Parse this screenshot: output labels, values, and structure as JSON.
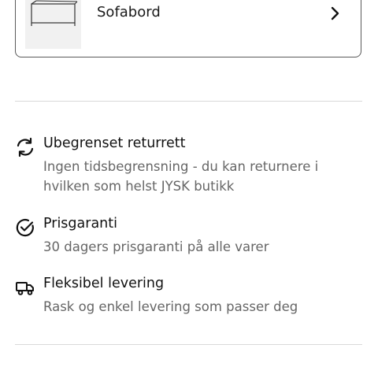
{
  "product_card": {
    "title": "Sofabord",
    "thumbnail_icon": "coffee-table-image",
    "chevron_icon": "chevron-right-icon"
  },
  "features": [
    {
      "icon": "refresh-icon",
      "title": "Ubegrenset returrett",
      "description": "Ingen tidsbegrensning - du kan returnere i hvilken som helst JYSK butikk"
    },
    {
      "icon": "check-circle-icon",
      "title": "Prisgaranti",
      "description": "30 dagers prisgaranti på alle varer"
    },
    {
      "icon": "truck-icon",
      "title": "Fleksibel levering",
      "description": "Rask og enkel levering som passer deg"
    }
  ]
}
